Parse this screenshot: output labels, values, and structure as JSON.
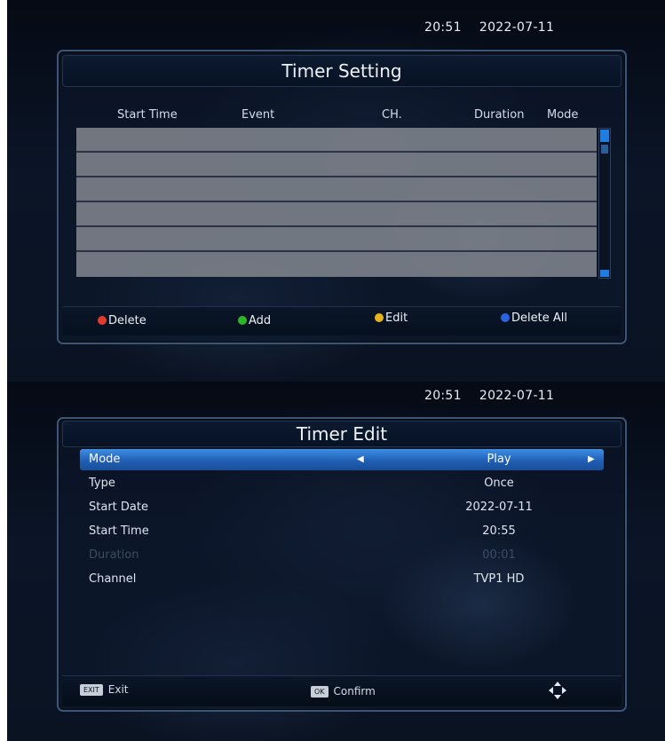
{
  "timer_setting": {
    "clock": {
      "time": "20:51",
      "date": "2022-07-11"
    },
    "title": "Timer Setting",
    "columns": [
      "Start Time",
      "Event",
      "CH.",
      "Duration",
      "Mode"
    ],
    "rows": [
      {
        "start_time": "",
        "event": "",
        "ch": "",
        "duration": "",
        "mode": ""
      },
      {
        "start_time": "",
        "event": "",
        "ch": "",
        "duration": "",
        "mode": ""
      },
      {
        "start_time": "",
        "event": "",
        "ch": "",
        "duration": "",
        "mode": ""
      },
      {
        "start_time": "",
        "event": "",
        "ch": "",
        "duration": "",
        "mode": ""
      },
      {
        "start_time": "",
        "event": "",
        "ch": "",
        "duration": "",
        "mode": ""
      },
      {
        "start_time": "",
        "event": "",
        "ch": "",
        "duration": "",
        "mode": ""
      }
    ],
    "color_keys": [
      {
        "color": "#e23b2e",
        "label": "Delete"
      },
      {
        "color": "#2eb52a",
        "label": "Add"
      },
      {
        "color": "#e6b420",
        "label": "Edit"
      },
      {
        "color": "#2b62e0",
        "label": "Delete All"
      }
    ]
  },
  "timer_edit": {
    "clock": {
      "time": "20:51",
      "date": "2022-07-11"
    },
    "title": "Timer Edit",
    "fields": [
      {
        "label": "Mode",
        "value": "Play",
        "selected": true
      },
      {
        "label": "Type",
        "value": "Once"
      },
      {
        "label": "Start Date",
        "value": "2022-07-11"
      },
      {
        "label": "Start Time",
        "value": "20:55"
      },
      {
        "label": "Duration",
        "value": "00:01",
        "disabled": true
      },
      {
        "label": "Channel",
        "value": "TVP1 HD"
      }
    ],
    "footer": {
      "exit_key": "EXIT",
      "exit_label": "Exit",
      "ok_key": "OK",
      "ok_label": "Confirm",
      "nav_icon": "navigation-arrows-icon"
    },
    "accent_color": "#2f7bd8"
  }
}
